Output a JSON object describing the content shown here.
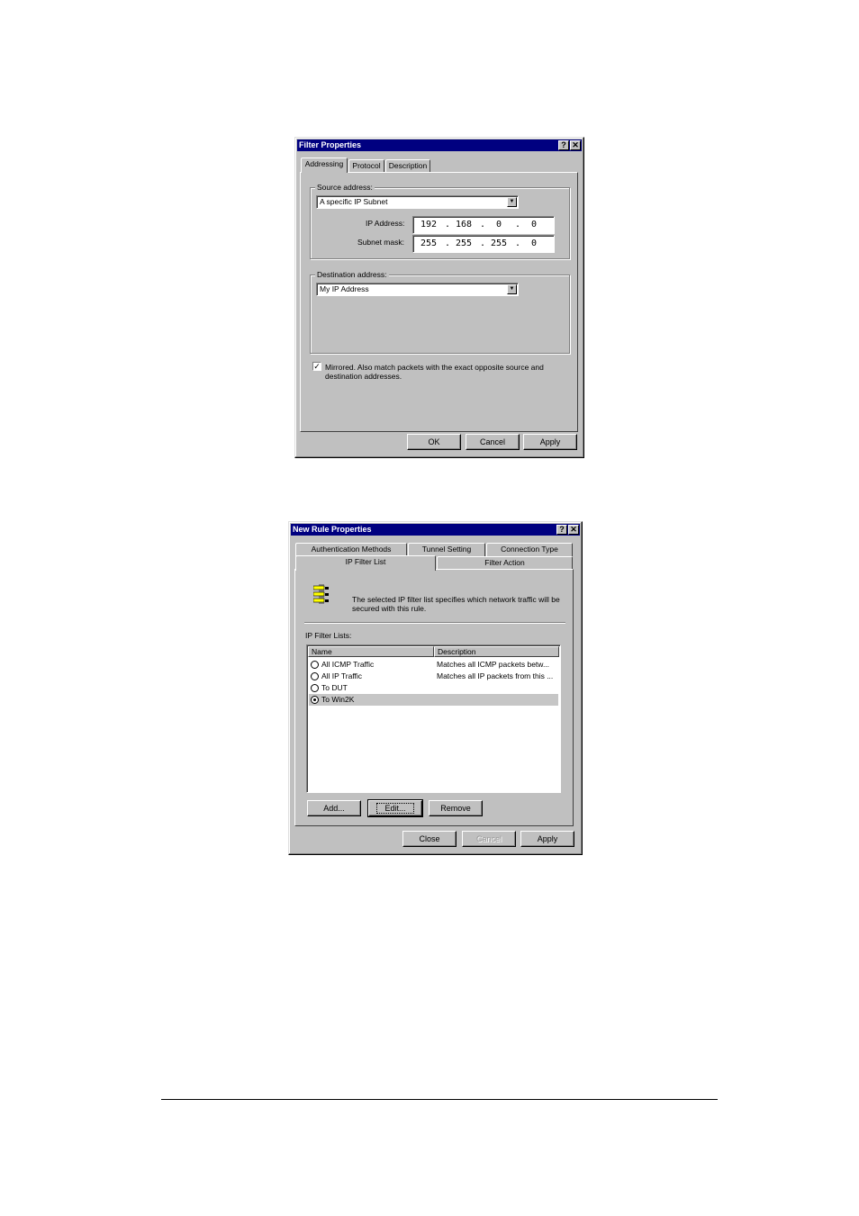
{
  "filter_dialog": {
    "title": "Filter Properties",
    "tabs": [
      {
        "label": "Addressing",
        "active": true
      },
      {
        "label": "Protocol",
        "active": false
      },
      {
        "label": "Description",
        "active": false
      }
    ],
    "source_group_label": "Source address:",
    "source_combo_value": "A specific IP Subnet",
    "ip_address_label": "IP Address:",
    "ip_address": [
      "192",
      "168",
      "0",
      "0"
    ],
    "subnet_mask_label": "Subnet mask:",
    "subnet_mask": [
      "255",
      "255",
      "255",
      "0"
    ],
    "destination_group_label": "Destination address:",
    "destination_combo_value": "My IP Address",
    "mirrored_checked": true,
    "mirrored_line1": "Mirrored. Also match packets with the exact opposite source and",
    "mirrored_line2": "destination addresses.",
    "buttons": {
      "ok": "OK",
      "cancel": "Cancel",
      "apply": "Apply"
    }
  },
  "rule_dialog": {
    "title": "New Rule Properties",
    "tabs_back": [
      {
        "label": "Authentication Methods"
      },
      {
        "label": "Tunnel Setting"
      },
      {
        "label": "Connection Type"
      }
    ],
    "tabs_front": [
      {
        "label": "IP Filter List",
        "active": true
      },
      {
        "label": "Filter Action",
        "active": false
      }
    ],
    "info_line1": "The selected IP filter list specifies which network traffic will be",
    "info_line2": "secured with this rule.",
    "list_label": "IP Filter Lists:",
    "columns": [
      "Name",
      "Description"
    ],
    "rows": [
      {
        "name": "All ICMP Traffic",
        "description": "Matches all ICMP packets betw...",
        "selected": false
      },
      {
        "name": "All IP Traffic",
        "description": "Matches all IP packets from this ...",
        "selected": false
      },
      {
        "name": "To DUT",
        "description": "",
        "selected": false
      },
      {
        "name": "To Win2K",
        "description": "",
        "selected": true
      }
    ],
    "buttons": {
      "add": "Add...",
      "edit": "Edit...",
      "remove": "Remove",
      "close": "Close",
      "cancel": "Cancel",
      "apply": "Apply"
    }
  }
}
